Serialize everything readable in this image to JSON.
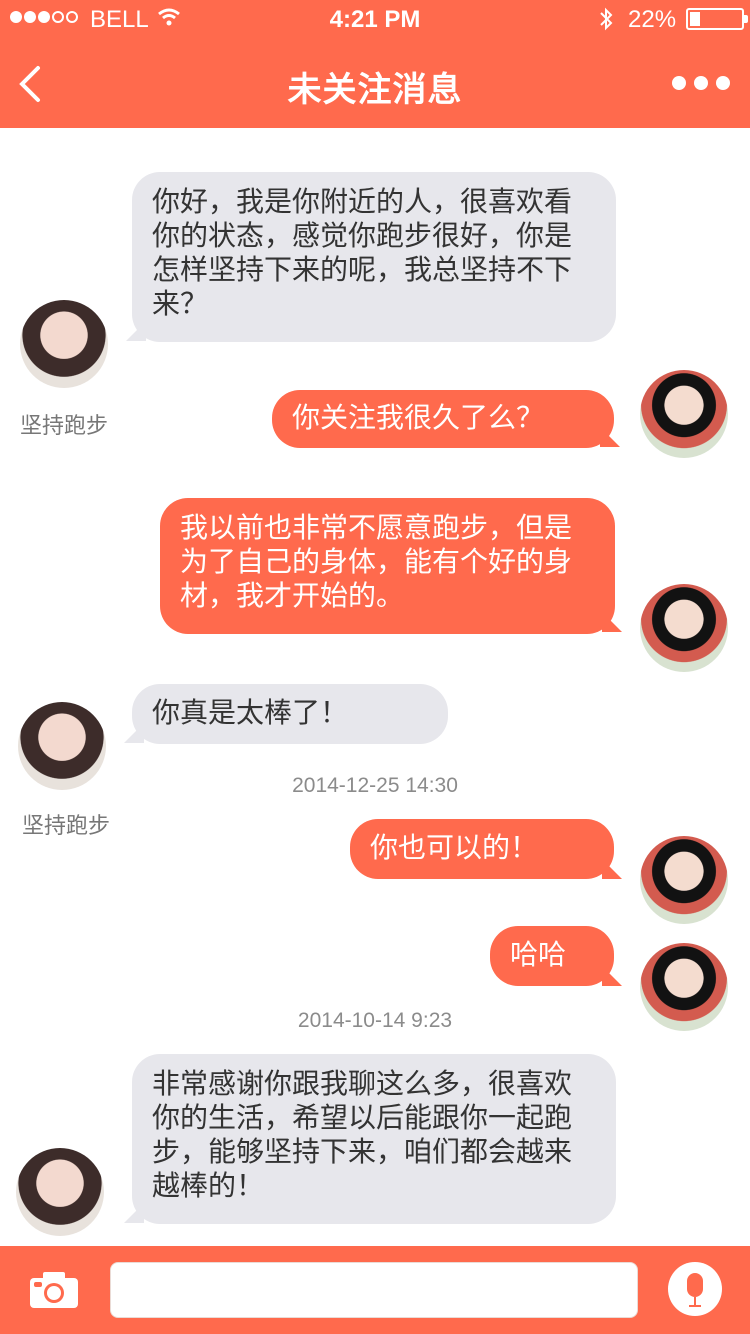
{
  "status_bar": {
    "carrier": "BELL",
    "time": "4:21 PM",
    "battery": "22%"
  },
  "header": {
    "title": "未关注消息",
    "icons": {
      "back": "chevron-left-icon",
      "more": "more-dots-icon"
    }
  },
  "conversation": [
    {
      "side": "in",
      "text": "你好，我是你附近的人，很喜欢看你的状态，感觉你跑步很好，你是怎样坚持下来的呢，我总坚持不下来？",
      "sender": "坚持跑步"
    },
    {
      "side": "out",
      "text": "你关注我很久了么？"
    },
    {
      "side": "out",
      "text": "我以前也非常不愿意跑步，但是为了自己的身体，能有个好的身材，我才开始的。"
    },
    {
      "side": "in",
      "text": "你真是太棒了！",
      "sender": "坚持跑步"
    },
    {
      "type": "timestamp",
      "text": "2014-12-25 14:30"
    },
    {
      "side": "out",
      "text": "你也可以的！"
    },
    {
      "side": "out",
      "text": "哈哈"
    },
    {
      "type": "timestamp",
      "text": "2014-10-14 9:23"
    },
    {
      "side": "in",
      "text": "非常感谢你跟我聊这么多，很喜欢你的生活，希望以后能跟你一起跑步，能够坚持下来，咱们都会越来越棒的！"
    }
  ],
  "bottom_bar": {
    "icons": {
      "camera": "camera-icon",
      "mic": "microphone-icon"
    },
    "input_value": ""
  },
  "colors": {
    "accent": "#ff6a4d",
    "incoming_bubble": "#e7e7ec",
    "outgoing_text": "#ffffff"
  }
}
